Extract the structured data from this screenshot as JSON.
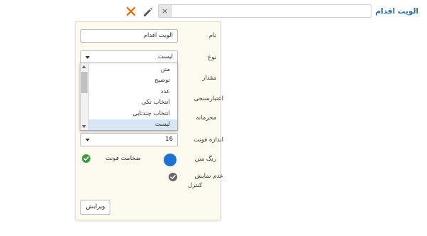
{
  "header": {
    "title": "الویت اقدام",
    "clear_symbol": "×"
  },
  "form": {
    "name_label": "نام",
    "name_value": "الویت اقدام",
    "type_label": "نوع",
    "type_value": "لیست",
    "value_label": "مقدار",
    "validation_label": "اعتبارسنجی",
    "confidential_label": "محرمانه",
    "font_size_label": "اندازه فونت",
    "font_size_value": "16",
    "text_color_label": "رنگ متن",
    "text_color": "#1e73d2",
    "font_bold_label": "ضخامت فونت",
    "hide_control_label_1": "عدم نمایش",
    "hide_control_label_2": "کنترل",
    "edit_button": "ویرایش"
  },
  "type_options": {
    "items": [
      "متن",
      "توضیح",
      "عدد",
      "انتخاب تکی",
      "انتخاب چندتایی",
      "لیست"
    ],
    "selected": "لیست"
  },
  "colors": {
    "accent_title": "#2b6cb0",
    "close_x": "#e07020",
    "check_green": "#3a9d3a",
    "check_gray": "#666666"
  },
  "icons": {
    "edit": "pencil-icon",
    "close": "close-icon",
    "bold_check": "check-circle-icon",
    "hide_check": "check-circle-icon"
  }
}
